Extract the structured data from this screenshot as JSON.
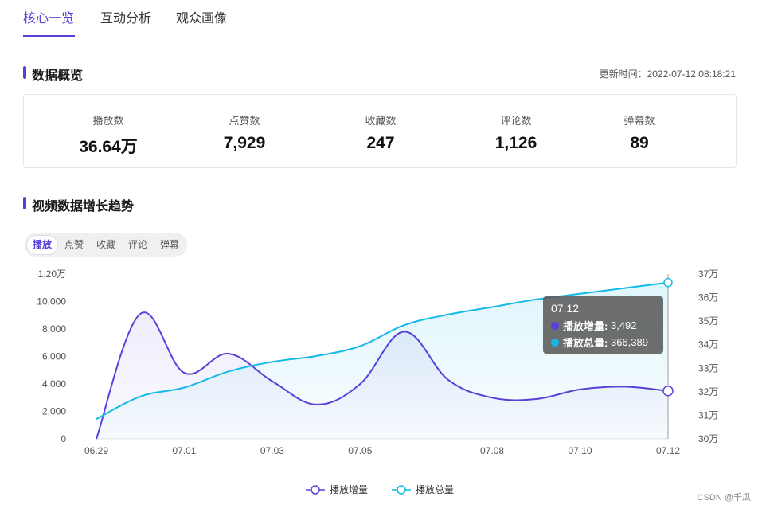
{
  "tabs": [
    {
      "label": "核心一览"
    },
    {
      "label": "互动分析"
    },
    {
      "label": "观众画像"
    }
  ],
  "overview": {
    "title": "数据概览",
    "update_time": "更新时间：2022-07-12 08:18:21",
    "stats": [
      {
        "label": "播放数",
        "value": "36.64万"
      },
      {
        "label": "点赞数",
        "value": "7,929"
      },
      {
        "label": "收藏数",
        "value": "247"
      },
      {
        "label": "评论数",
        "value": "1,126"
      },
      {
        "label": "弹幕数",
        "value": "89"
      }
    ]
  },
  "trend": {
    "title": "视频数据增长趋势",
    "metric_buttons": [
      {
        "label": "播放",
        "active": true
      },
      {
        "label": "点赞"
      },
      {
        "label": "收藏"
      },
      {
        "label": "评论"
      },
      {
        "label": "弹幕"
      }
    ]
  },
  "colors": {
    "accent": "#5a3fd6",
    "series_increment": "#5b3fd9",
    "series_total": "#14b9e8"
  },
  "tooltip": {
    "title": "07.12",
    "rows": [
      {
        "name": "播放增量:",
        "value": "3,492",
        "color": "#5b3fd9"
      },
      {
        "name": "播放总量:",
        "value": "366,389",
        "color": "#14b9e8"
      }
    ]
  },
  "watermark": "CSDN @千瓜",
  "chart_data": {
    "type": "line",
    "categories": [
      "06.29",
      "06.30",
      "07.01",
      "07.02",
      "07.03",
      "07.04",
      "07.05",
      "07.06",
      "07.07",
      "07.08",
      "07.09",
      "07.10",
      "07.11",
      "07.12"
    ],
    "x_tick_labels": [
      "06.29",
      "07.01",
      "07.03",
      "07.05",
      "07.08",
      "07.10",
      "07.12"
    ],
    "y_left": {
      "ticks": [
        "0",
        "2,000",
        "4,000",
        "6,000",
        "8,000",
        "10,000",
        "1.20万"
      ],
      "ylim": [
        0,
        12000
      ]
    },
    "y_right": {
      "ticks": [
        "30万",
        "31万",
        "32万",
        "33万",
        "34万",
        "35万",
        "36万",
        "37万"
      ],
      "ylim": [
        300000,
        370000
      ]
    },
    "series": [
      {
        "name": "播放增量",
        "axis": "left",
        "values": [
          0,
          9100,
          4800,
          6200,
          4200,
          2500,
          4000,
          7800,
          4300,
          3000,
          2900,
          3600,
          3800,
          3492
        ]
      },
      {
        "name": "播放总量",
        "axis": "right",
        "values": [
          308400,
          318000,
          321800,
          328600,
          332700,
          335200,
          339400,
          348300,
          352800,
          356000,
          359200,
          361600,
          364000,
          366389
        ]
      }
    ],
    "legend_position": "bottom-center",
    "grid": false
  }
}
